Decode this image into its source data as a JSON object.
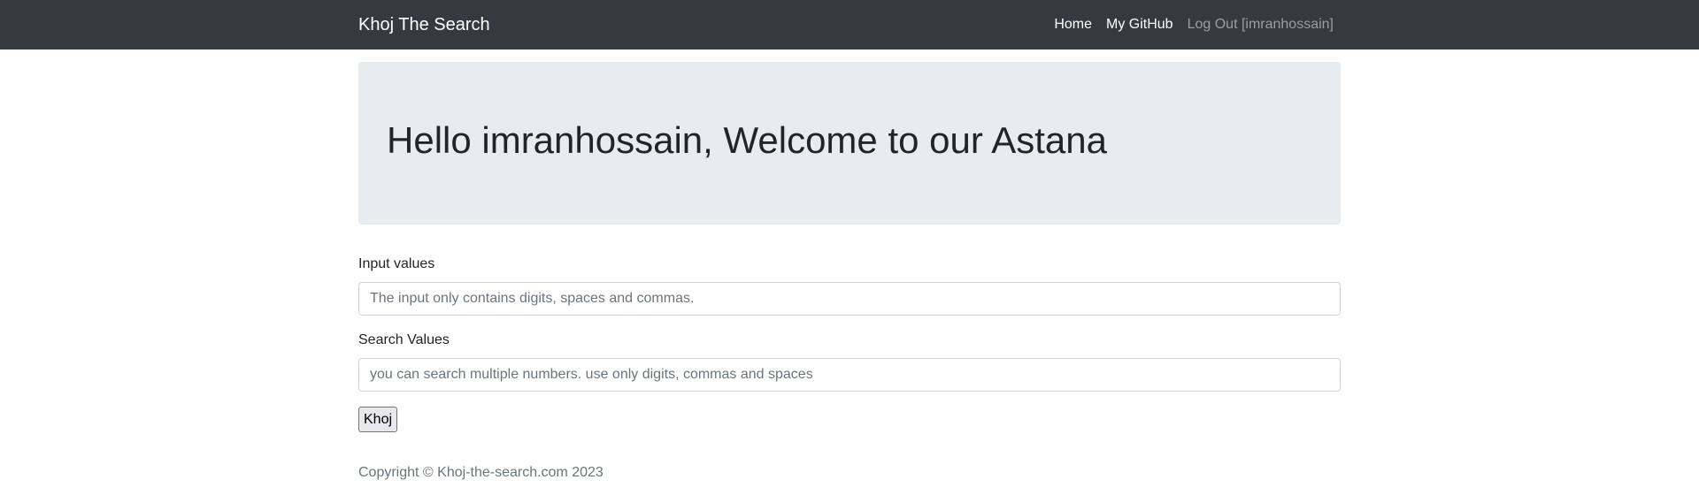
{
  "navbar": {
    "brand": "Khoj The Search",
    "links": [
      {
        "label": "Home"
      },
      {
        "label": "My GitHub"
      },
      {
        "label": "Log Out [imranhossain]"
      }
    ]
  },
  "jumbotron": {
    "heading": "Hello imranhossain, Welcome to our Astana"
  },
  "form": {
    "input_values": {
      "label": "Input values",
      "value": "",
      "placeholder": "The input only contains digits, spaces and commas."
    },
    "search_values": {
      "label": "Search Values",
      "value": "",
      "placeholder": "you can search multiple numbers. use only digits, commas and spaces"
    },
    "submit_label": "Khoj"
  },
  "footer": {
    "copyright": "Copyright © Khoj-the-search.com 2023"
  },
  "colors": {
    "navbar_bg": "#343a40",
    "jumbotron_bg": "#e9ecef",
    "text": "#212529",
    "muted": "#6c757d"
  }
}
